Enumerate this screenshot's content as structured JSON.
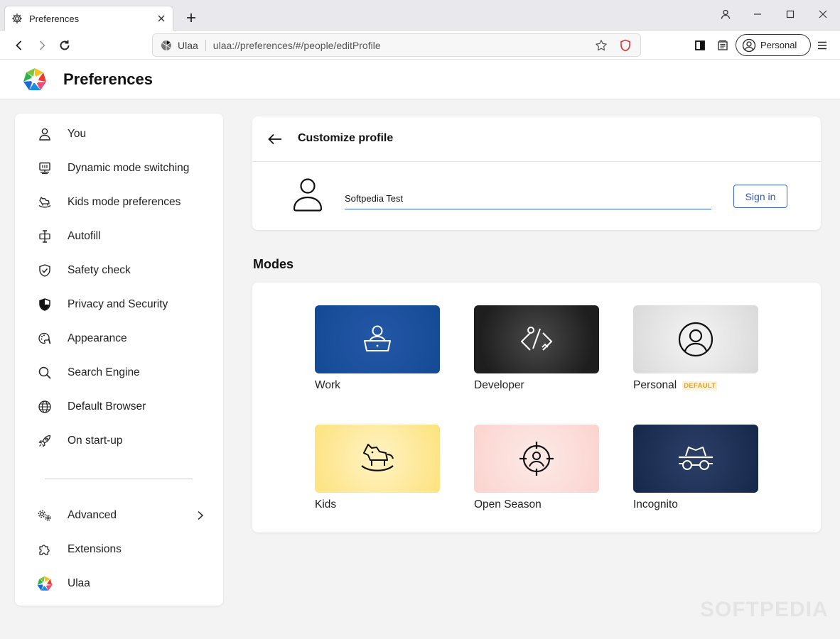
{
  "tab": {
    "title": "Preferences"
  },
  "urlbar": {
    "site_name": "Ulaa",
    "url": "ulaa://preferences/#/people/editProfile"
  },
  "profile_button": {
    "label": "Personal"
  },
  "header": {
    "title": "Preferences"
  },
  "sidebar": {
    "items": [
      {
        "label": "You",
        "icon": "person-icon"
      },
      {
        "label": "Dynamic mode switching",
        "icon": "monitor-icon"
      },
      {
        "label": "Kids mode preferences",
        "icon": "rocking-horse-icon"
      },
      {
        "label": "Autofill",
        "icon": "autofill-icon"
      },
      {
        "label": "Safety check",
        "icon": "shield-check-icon"
      },
      {
        "label": "Privacy and Security",
        "icon": "shield-icon"
      },
      {
        "label": "Appearance",
        "icon": "palette-icon"
      },
      {
        "label": "Search Engine",
        "icon": "search-icon"
      },
      {
        "label": "Default Browser",
        "icon": "globe-icon"
      },
      {
        "label": "On start-up",
        "icon": "rocket-icon"
      }
    ],
    "advanced": {
      "label": "Advanced",
      "icon": "gears-icon"
    },
    "extensions": {
      "label": "Extensions",
      "icon": "puzzle-icon"
    },
    "ulaa": {
      "label": "Ulaa",
      "icon": "ulaa-logo-icon"
    }
  },
  "profile_card": {
    "title": "Customize profile",
    "name_value": "Softpedia Test",
    "signin_label": "Sign in"
  },
  "modes": {
    "title": "Modes",
    "items": [
      {
        "label": "Work",
        "icon": "laptop-user-icon",
        "color": "#1b4f9a"
      },
      {
        "label": "Developer",
        "icon": "code-icon",
        "color": "#2a2a2a"
      },
      {
        "label": "Personal",
        "icon": "user-circle-icon",
        "color": "#e4e4e4",
        "badge": "DEFAULT"
      },
      {
        "label": "Kids",
        "icon": "rocking-horse-icon",
        "color": "#fde58a"
      },
      {
        "label": "Open Season",
        "icon": "crosshair-user-icon",
        "color": "#fbd9d5"
      },
      {
        "label": "Incognito",
        "icon": "incognito-icon",
        "color": "#1e2f54"
      }
    ]
  },
  "watermark": "SOFTPEDIA"
}
